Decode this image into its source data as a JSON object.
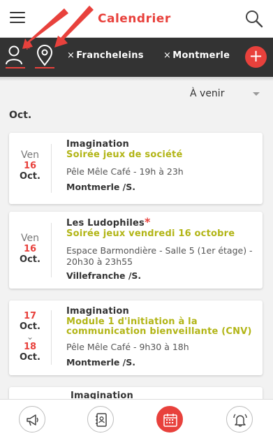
{
  "app": {
    "title": "Calendrier"
  },
  "filters": {
    "user_star": "*",
    "chips": [
      {
        "x": "×",
        "label": "Francheleins"
      },
      {
        "x": "×",
        "label": "Montmerle"
      }
    ],
    "add_symbol": "+"
  },
  "sort": {
    "value": "À venir"
  },
  "month": "Oct.",
  "events": [
    {
      "dow": "Ven",
      "day": "16",
      "mon": "Oct.",
      "org": "Imagination",
      "org_star": "",
      "title": "Soirée jeux de société",
      "place": "Pêle Mêle Café - 19h à 23h",
      "city": "Montmerle /S."
    },
    {
      "dow": "Ven",
      "day": "16",
      "mon": "Oct.",
      "org": "Les Ludophiles",
      "org_star": "*",
      "title": "Soirée jeux vendredi 16 octobre",
      "place": "Espace Barmondière - Salle 5 (1er étage) - 20h30 à 23h55",
      "city": "Villefranche /S."
    },
    {
      "day_from": "17",
      "mon_from": "Oct.",
      "chevron": "⌄",
      "day_to": "18",
      "mon_to": "Oct.",
      "org": "Imagination",
      "title": "Module 1 d'initiation à la communication bienveillante (CNV)",
      "place": "Pêle Mêle Café - 9h30 à 18h",
      "city": "Montmerle /S."
    },
    {
      "org": "Imagination"
    }
  ],
  "colors": {
    "accent": "#e8413c",
    "title_green": "#b2b516",
    "filterbar": "#333333"
  },
  "icons": {
    "menu": "menu-icon",
    "search": "search-icon",
    "user_filter": "user-icon",
    "location_filter": "location-pin-icon",
    "nav": [
      "megaphone-icon",
      "address-book-icon",
      "calendar-icon",
      "bell-icon"
    ]
  }
}
